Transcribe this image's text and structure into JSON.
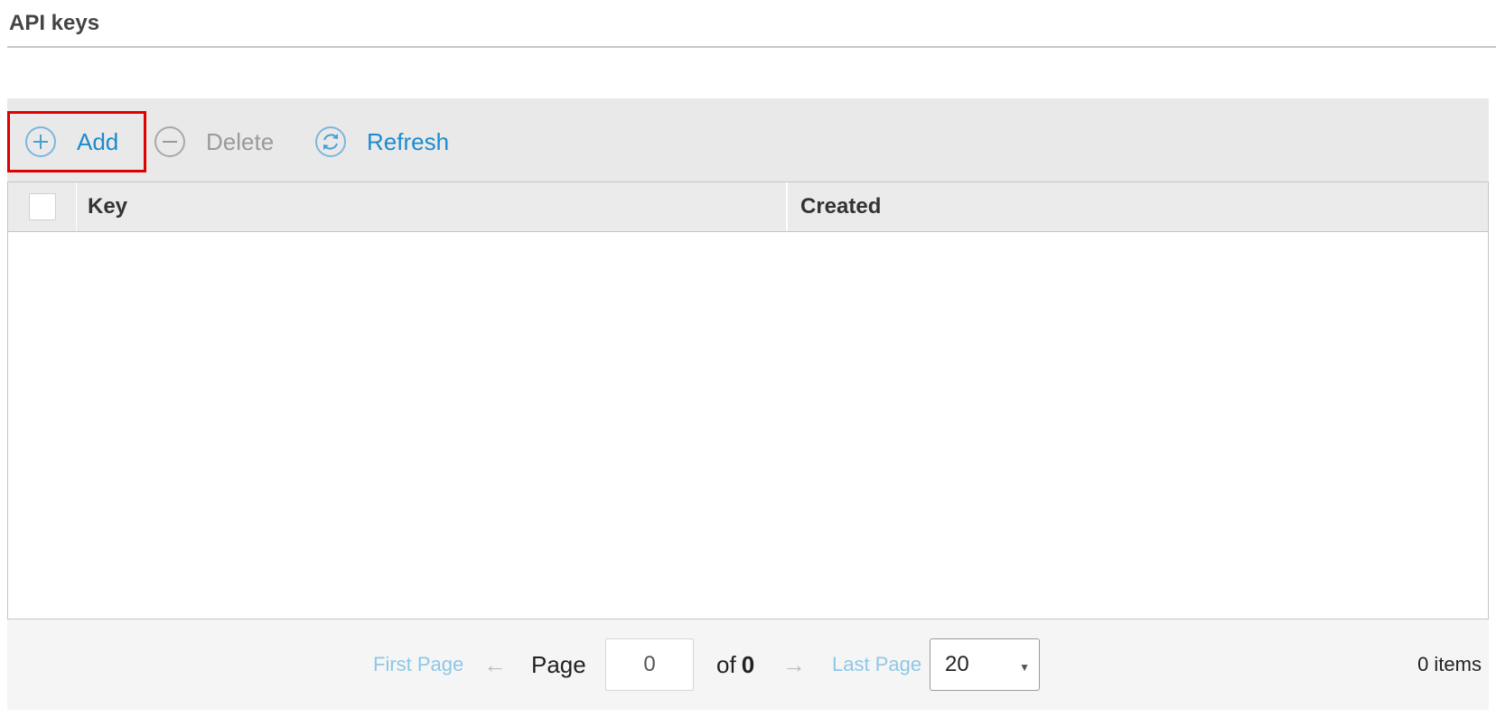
{
  "header": {
    "title": "API keys"
  },
  "toolbar": {
    "add_label": "Add",
    "delete_label": "Delete",
    "refresh_label": "Refresh"
  },
  "table": {
    "columns": [
      {
        "label": "Key"
      },
      {
        "label": "Created"
      }
    ],
    "rows": []
  },
  "pager": {
    "first_label": "First Page",
    "prev_arrow": "←",
    "page_label": "Page",
    "current_page": "0",
    "of_label": "of",
    "total_pages": "0",
    "next_arrow": "→",
    "last_label": "Last Page",
    "page_size": "20",
    "items_count": "0 items"
  },
  "colors": {
    "accent": "#1a8ccd",
    "highlight_border": "#e00000",
    "disabled": "#9a9a9a"
  },
  "icons": {
    "add": "plus-circle-icon",
    "delete": "minus-circle-icon",
    "refresh": "refresh-circle-icon",
    "page_size_caret": "caret-down-icon"
  }
}
